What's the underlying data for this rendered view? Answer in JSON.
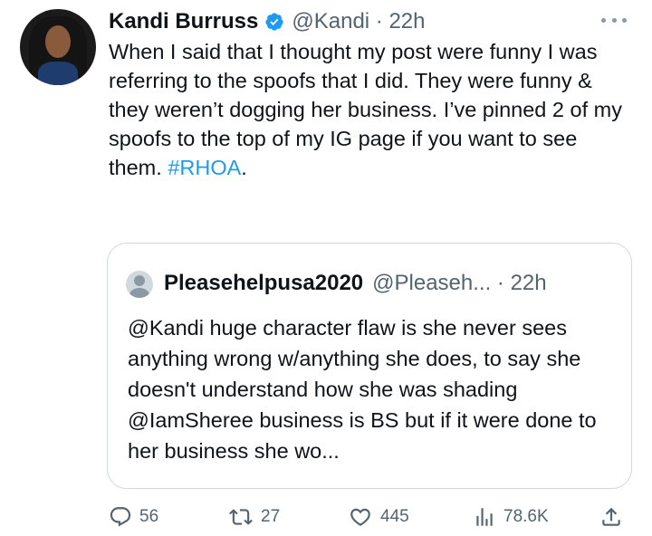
{
  "tweet": {
    "author_name": "Kandi Burruss",
    "handle_time": "@Kandi · 22h",
    "text": "When I said that I thought my post were funny I was referring to the spoofs that I did. They were funny & they weren’t dogging her business. I’ve pinned 2 of my spoofs to the top of my IG page if you want to see them.",
    "hashtag": "#RHOA",
    "hashtag_suffix": "."
  },
  "quote": {
    "author_name": "Pleasehelpusa2020",
    "handle_time": "@Pleaseh... · 22h",
    "text": "@Kandi huge character flaw is she never sees anything wrong w/anything she does, to say she doesn't understand how she was shading @IamSheree business is BS but if it were done to her business she wo..."
  },
  "actions": {
    "replies": "56",
    "retweets": "27",
    "likes": "445",
    "views": "78.6K"
  },
  "colors": {
    "link": "#1d9bf0",
    "verified": "#1d9bf0",
    "secondary_text": "#536471"
  },
  "icons": [
    "verified-badge-icon",
    "more-icon",
    "reply-icon",
    "retweet-icon",
    "like-icon",
    "views-icon",
    "share-icon"
  ]
}
